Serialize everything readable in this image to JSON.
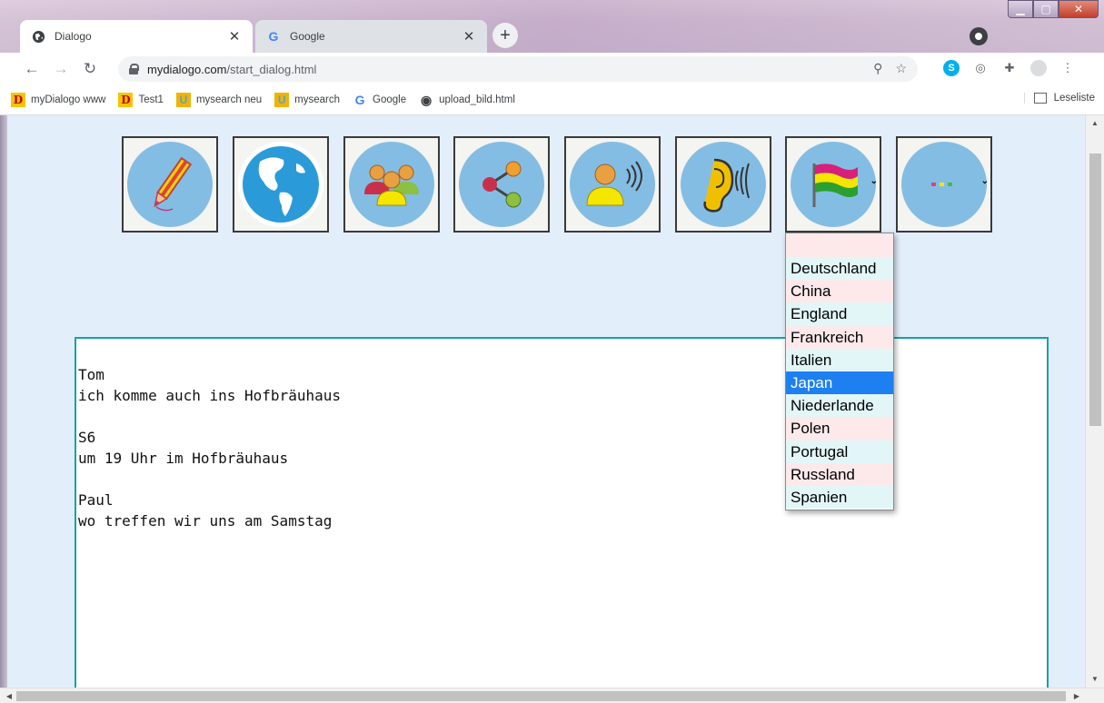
{
  "browser": {
    "tabs": [
      {
        "title": "Dialogo",
        "icon": "globe-icon"
      },
      {
        "title": "Google",
        "icon": "google-icon"
      }
    ],
    "address": {
      "host": "mydialogo.com",
      "path": "/start_dialog.html"
    },
    "bookmarks": [
      {
        "label": "myDialogo www",
        "icon": "D"
      },
      {
        "label": "Test1",
        "icon": "D"
      },
      {
        "label": "mysearch neu",
        "icon": "U"
      },
      {
        "label": "mysearch",
        "icon": "U"
      },
      {
        "label": "Google",
        "icon": "G"
      },
      {
        "label": "upload_bild.html",
        "icon": "globe"
      }
    ],
    "reading_list": "Leseliste"
  },
  "toolbar_icons": [
    {
      "name": "pencil-icon"
    },
    {
      "name": "globe-earth-icon"
    },
    {
      "name": "group-people-icon"
    },
    {
      "name": "share-icon"
    },
    {
      "name": "speaker-person-icon"
    },
    {
      "name": "ear-listen-icon"
    },
    {
      "name": "flag-language-icon"
    },
    {
      "name": "more-dots-icon"
    }
  ],
  "language_dropdown": {
    "options": [
      "Deutschland",
      "China",
      "England",
      "Frankreich",
      "Italien",
      "Japan",
      "Niederlande",
      "Polen",
      "Portugal",
      "Russland",
      "Spanien"
    ],
    "selected": "Japan"
  },
  "chat": [
    {
      "name": "Tom",
      "message": "ich komme auch ins Hofbräuhaus"
    },
    {
      "name": "S6",
      "message": "um 19 Uhr im Hofbräuhaus"
    },
    {
      "name": "Paul",
      "message": "wo treffen wir uns am Samstag"
    }
  ],
  "colors": {
    "page_bg": "#e3eefb",
    "icon_circle": "#84bde3",
    "chat_border": "#1aa0a4",
    "dropdown_selected": "#1e80f0"
  }
}
